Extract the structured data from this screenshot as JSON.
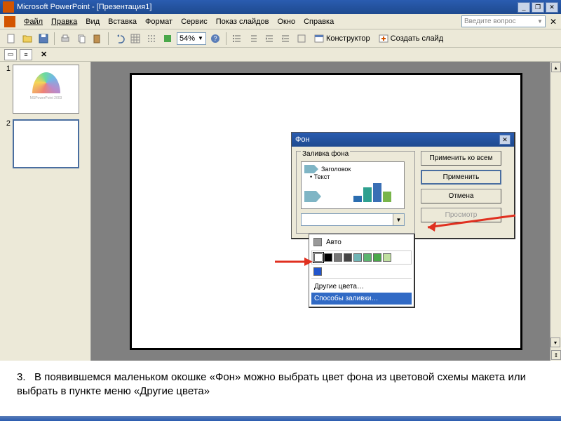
{
  "title": "Microsoft PowerPoint - [Презентация1]",
  "menu": {
    "items": [
      "Файл",
      "Правка",
      "Вид",
      "Вставка",
      "Формат",
      "Сервис",
      "Показ слайдов",
      "Окно",
      "Справка"
    ],
    "question_placeholder": "Введите вопрос"
  },
  "toolbar": {
    "zoom": "54%",
    "constructor": "Конструктор",
    "new_slide": "Создать слайд"
  },
  "thumbs": {
    "slide1_caption": "MSPowerPoint 2003"
  },
  "dialog": {
    "title": "Фон",
    "group_label": "Заливка фона",
    "preview_title": "Заголовок",
    "preview_text": "Текст",
    "apply_all": "Применить ко всем",
    "apply": "Применить",
    "cancel": "Отмена",
    "preview_btn": "Просмотр"
  },
  "color_menu": {
    "auto": "Авто",
    "swatches": [
      "#ffffff",
      "#000000",
      "#777777",
      "#444444",
      "#6fb5b5",
      "#5bb56f",
      "#4aa84a",
      "#c0e0a0"
    ],
    "recent": "#2255cc",
    "other_colors": "Другие цвета…",
    "fill_methods": "Способы заливки…"
  },
  "chart_data": {
    "type": "bar",
    "values": [
      15,
      35,
      45,
      25
    ],
    "colors": [
      "#2b6db0",
      "#2ea08f",
      "#3a6fb5",
      "#78b54a"
    ]
  },
  "caption_num": "3.",
  "caption_text": "В появившемся маленьком окошке «Фон» можно выбрать цвет фона из цветовой схемы макета или выбрать в пункте меню «Другие цвета»"
}
